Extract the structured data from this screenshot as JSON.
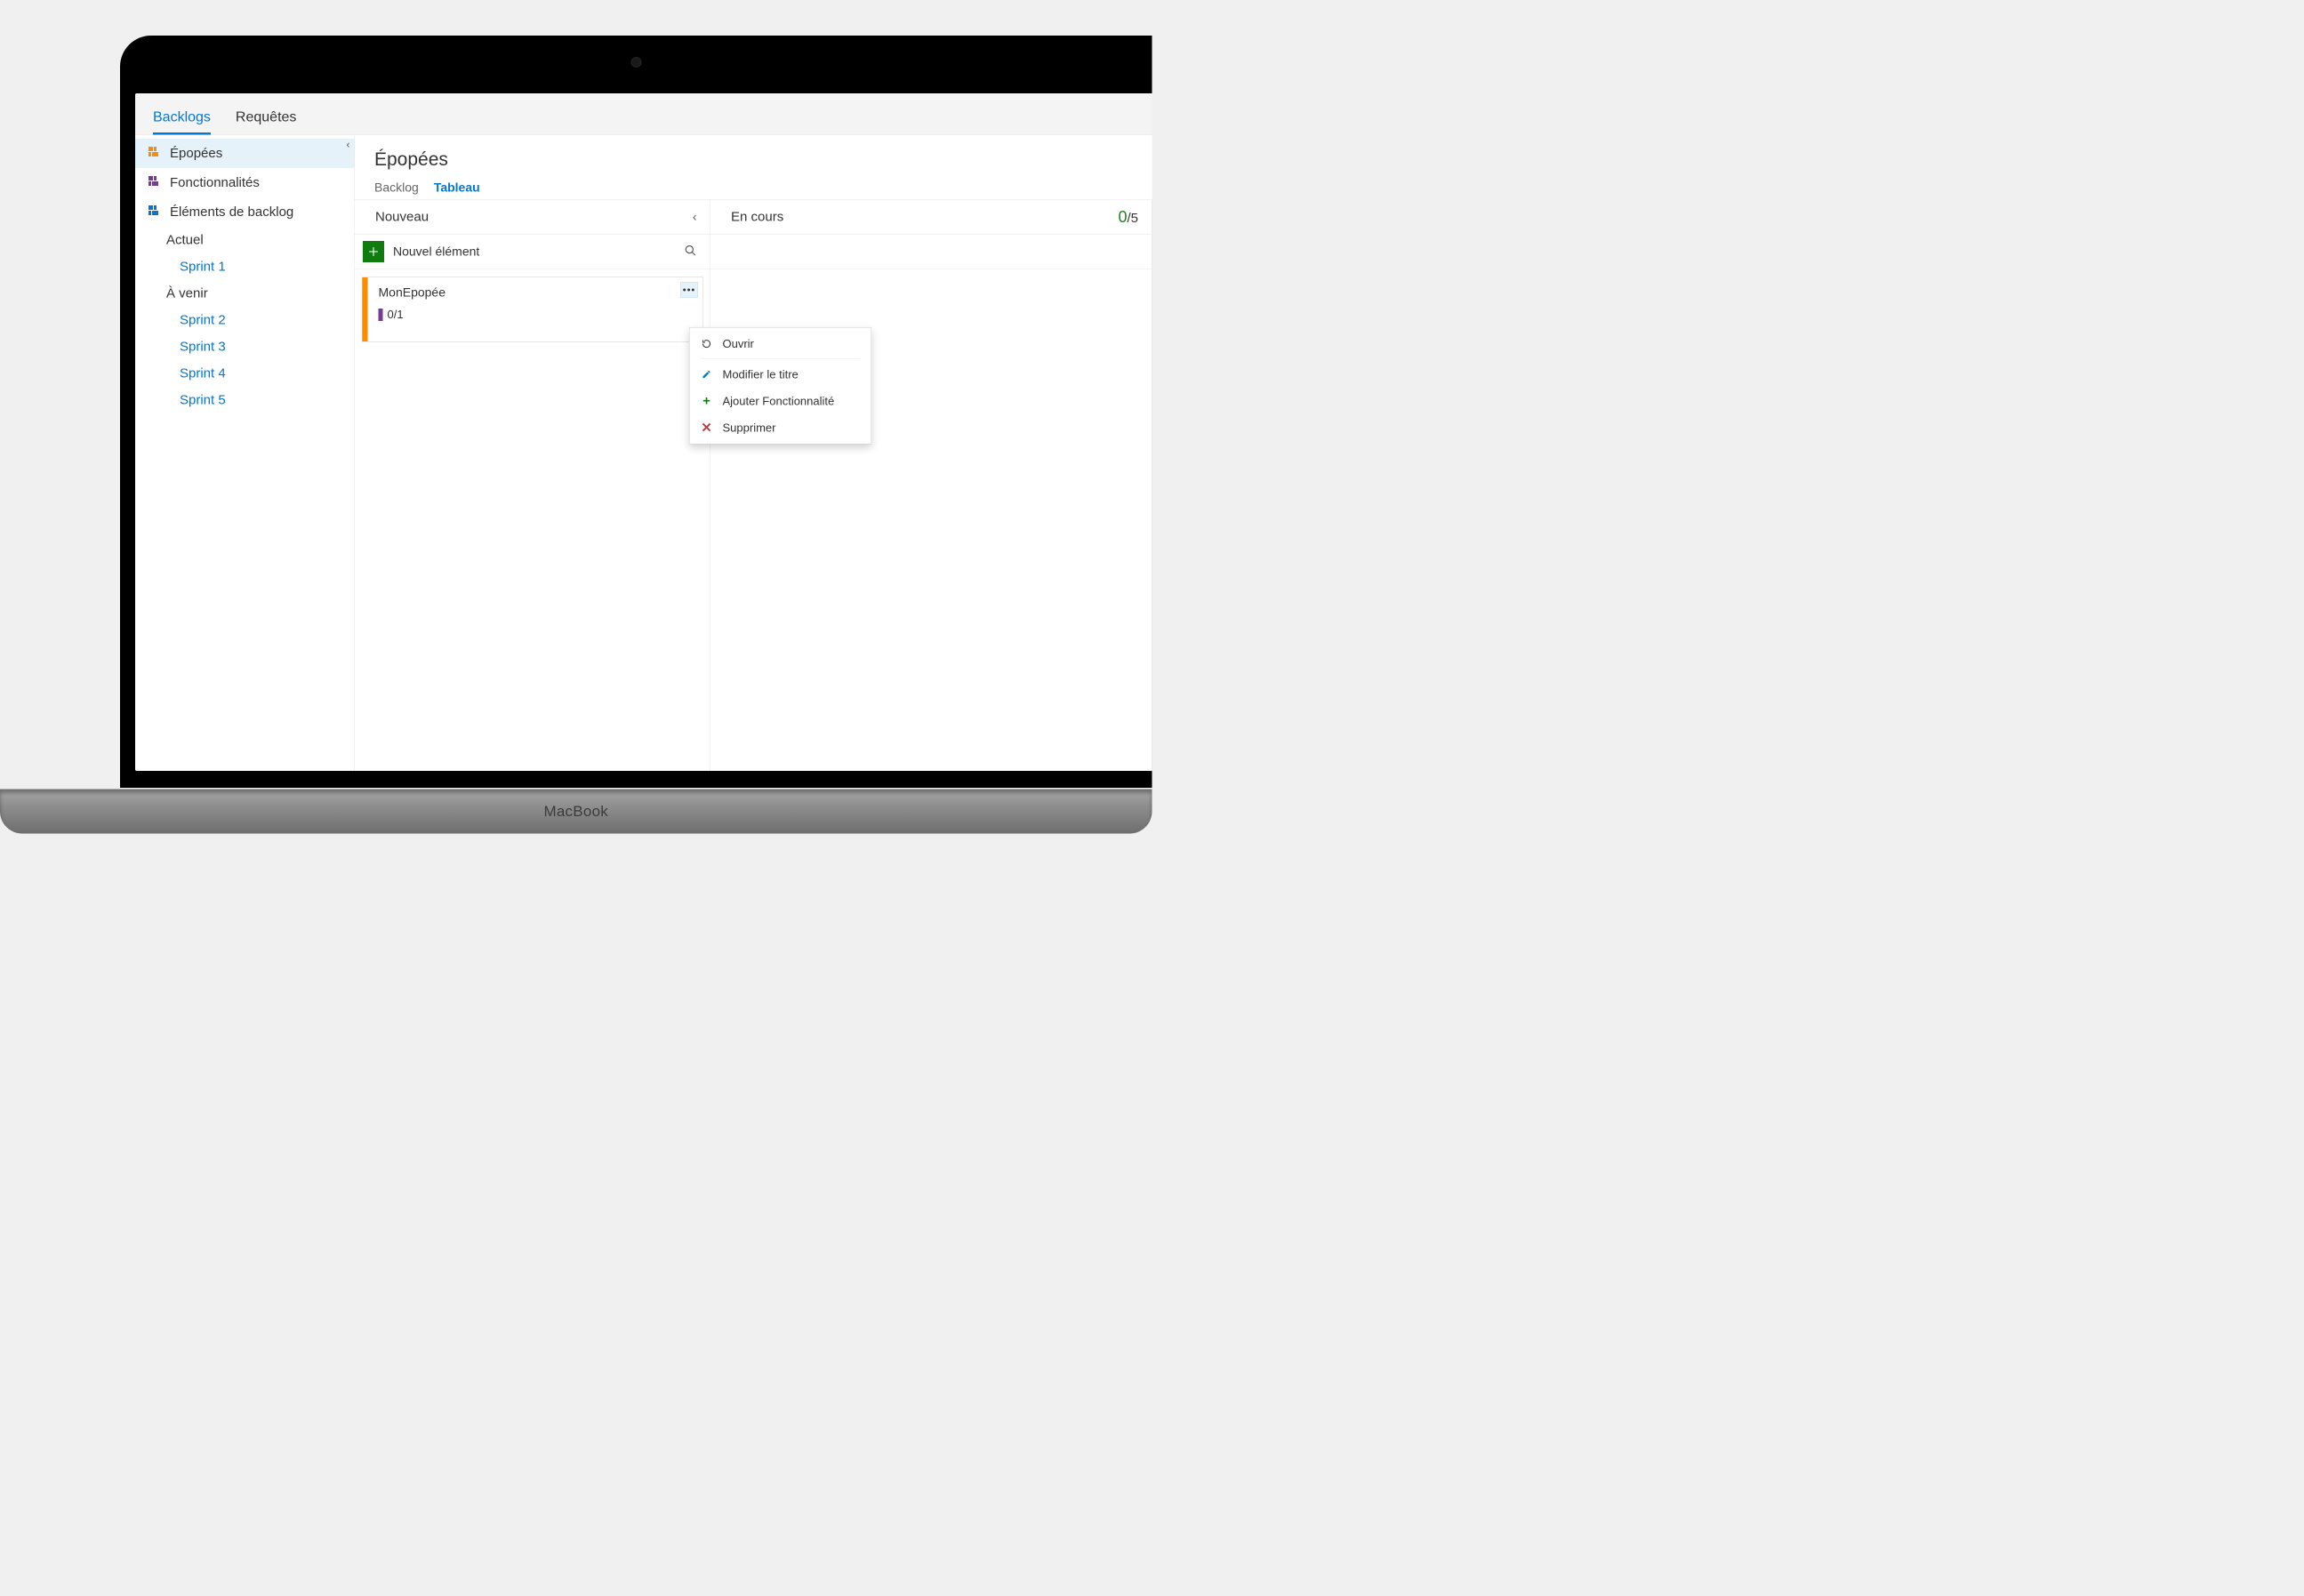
{
  "device_label": "MacBook",
  "top_tabs": {
    "active": "Backlogs",
    "inactive": "Requêtes"
  },
  "sidebar": {
    "items": [
      {
        "label": "Épopées",
        "icon": "orange",
        "active": true
      },
      {
        "label": "Fonctionnalités",
        "icon": "purple",
        "active": false
      },
      {
        "label": "Éléments de backlog",
        "icon": "blue",
        "active": false
      }
    ],
    "current_section": "Actuel",
    "current_sprints": [
      "Sprint 1"
    ],
    "upcoming_section": "À venir",
    "upcoming_sprints": [
      "Sprint 2",
      "Sprint 3",
      "Sprint 4",
      "Sprint 5"
    ]
  },
  "page": {
    "title": "Épopées",
    "subtab_inactive": "Backlog",
    "subtab_active": "Tableau"
  },
  "board": {
    "col1": {
      "title": "Nouveau",
      "new_item_label": "Nouvel élément",
      "card": {
        "title": "MonEpopée",
        "count": "0/1"
      }
    },
    "col2": {
      "title": "En cours",
      "capacity_done": "0",
      "capacity_total": "/5"
    }
  },
  "context_menu": {
    "open": "Ouvrir",
    "edit_title": "Modifier le titre",
    "add_feature": "Ajouter Fonctionnalité",
    "delete": "Supprimer"
  }
}
